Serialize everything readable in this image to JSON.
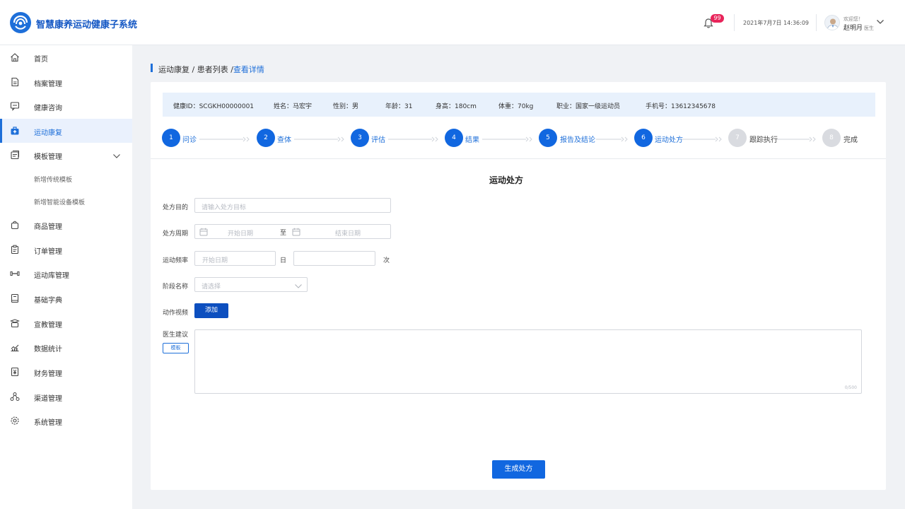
{
  "header": {
    "app_title": "智慧康养运动健康子系统",
    "notification_count": "99",
    "datetime": "2021年7月7日 14:36:09",
    "welcome": "欢迎您！",
    "username": "赵明月",
    "role": "医生"
  },
  "sidebar": {
    "items": [
      {
        "label": "首页",
        "icon": "home-icon"
      },
      {
        "label": "档案管理",
        "icon": "file-icon"
      },
      {
        "label": "健康咨询",
        "icon": "chat-icon"
      },
      {
        "label": "运动康复",
        "icon": "medkit-icon"
      },
      {
        "label": "模板管理",
        "icon": "template-icon"
      },
      {
        "label": "新增传统模板"
      },
      {
        "label": "新增智能设备模板"
      },
      {
        "label": "商品管理",
        "icon": "bag-icon"
      },
      {
        "label": "订单管理",
        "icon": "clipboard-icon"
      },
      {
        "label": "运动库管理",
        "icon": "dumbbell-icon"
      },
      {
        "label": "基础字典",
        "icon": "book-icon"
      },
      {
        "label": "宣教管理",
        "icon": "education-icon"
      },
      {
        "label": "数据统计",
        "icon": "chart-icon"
      },
      {
        "label": "财务管理",
        "icon": "finance-icon"
      },
      {
        "label": "渠道管理",
        "icon": "channel-icon"
      },
      {
        "label": "系统管理",
        "icon": "settings-icon"
      }
    ]
  },
  "breadcrumb": {
    "part1": "运动康复",
    "part2": "患者列表",
    "current": "查看详情"
  },
  "patient": {
    "health_id": "健康ID：SCGKH00000001",
    "name": "姓名：马宏宇",
    "gender": "性别：男",
    "age": "年龄：31",
    "height": "身高：180cm",
    "weight": "体重：70kg",
    "job": "职业：国家一级运动员",
    "phone": "手机号：13612345678"
  },
  "steps": [
    {
      "num": "1",
      "label": "问诊",
      "done": true
    },
    {
      "num": "2",
      "label": "查体",
      "done": true
    },
    {
      "num": "3",
      "label": "评估",
      "done": true
    },
    {
      "num": "4",
      "label": "结果",
      "done": true
    },
    {
      "num": "5",
      "label": "报告及结论",
      "done": true
    },
    {
      "num": "6",
      "label": "运动处方",
      "done": true
    },
    {
      "num": "7",
      "label": "跟踪执行",
      "done": false
    },
    {
      "num": "8",
      "label": "完成",
      "done": false
    }
  ],
  "form": {
    "title": "运动处方",
    "goal_label": "处方目的",
    "goal_placeholder": "请输入处方目标",
    "period_label": "处方周期",
    "start_placeholder": "开始日期",
    "to_text": "至",
    "end_placeholder": "结束日期",
    "freq_label": "运动频率",
    "freq_placeholder": "开始日期",
    "freq_unit_day": "日",
    "freq_unit_times": "次",
    "stage_label": "阶段名称",
    "stage_placeholder": "请选择",
    "video_label": "动作视频",
    "add_button": "添加",
    "advice_label": "医生建议",
    "template_button": "模板",
    "counter": "0/500",
    "generate_button": "生成处方"
  },
  "colors": {
    "primary": "#1167e0",
    "brand_text": "#1457c4",
    "badge": "#e8245a",
    "inactive_step": "#d9dbe0"
  }
}
